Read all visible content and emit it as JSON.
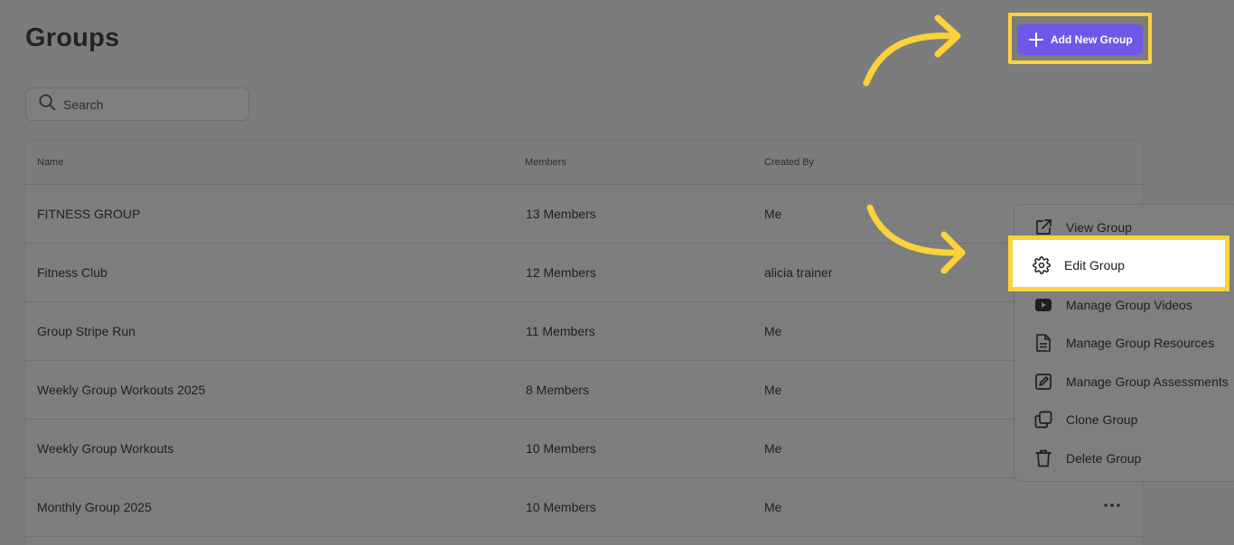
{
  "page": {
    "title": "Groups"
  },
  "search": {
    "placeholder": "Search"
  },
  "table": {
    "columns": {
      "name": "Name",
      "members": "Members",
      "created_by": "Created By"
    },
    "rows": [
      {
        "name": "FITNESS GROUP",
        "members": "13 Members",
        "created_by": "Me"
      },
      {
        "name": "Fitness Club",
        "members": "12 Members",
        "created_by": "alicia trainer"
      },
      {
        "name": "Group Stripe Run",
        "members": "11 Members",
        "created_by": "Me"
      },
      {
        "name": "Weekly Group Workouts 2025",
        "members": "8 Members",
        "created_by": "Me"
      },
      {
        "name": "Weekly Group Workouts",
        "members": "10 Members",
        "created_by": "Me"
      },
      {
        "name": "Monthly Group 2025",
        "members": "10 Members",
        "created_by": "Me"
      }
    ]
  },
  "toolbar": {
    "add_label": "Add New Group"
  },
  "menu": {
    "items": [
      {
        "label": "View Group",
        "icon": "external-link-icon"
      },
      {
        "label": "Edit Group",
        "icon": "gear-icon"
      },
      {
        "label": "Manage Group Videos",
        "icon": "youtube-icon"
      },
      {
        "label": "Manage Group Resources",
        "icon": "document-icon"
      },
      {
        "label": "Manage Group Assessments",
        "icon": "assessment-icon"
      },
      {
        "label": "Clone Group",
        "icon": "copy-icon"
      },
      {
        "label": "Delete Group",
        "icon": "trash-icon"
      }
    ]
  },
  "colors": {
    "overlay_bg": "#7c7c7c",
    "accent": "#6f57e8",
    "highlight": "#fcd23a"
  }
}
